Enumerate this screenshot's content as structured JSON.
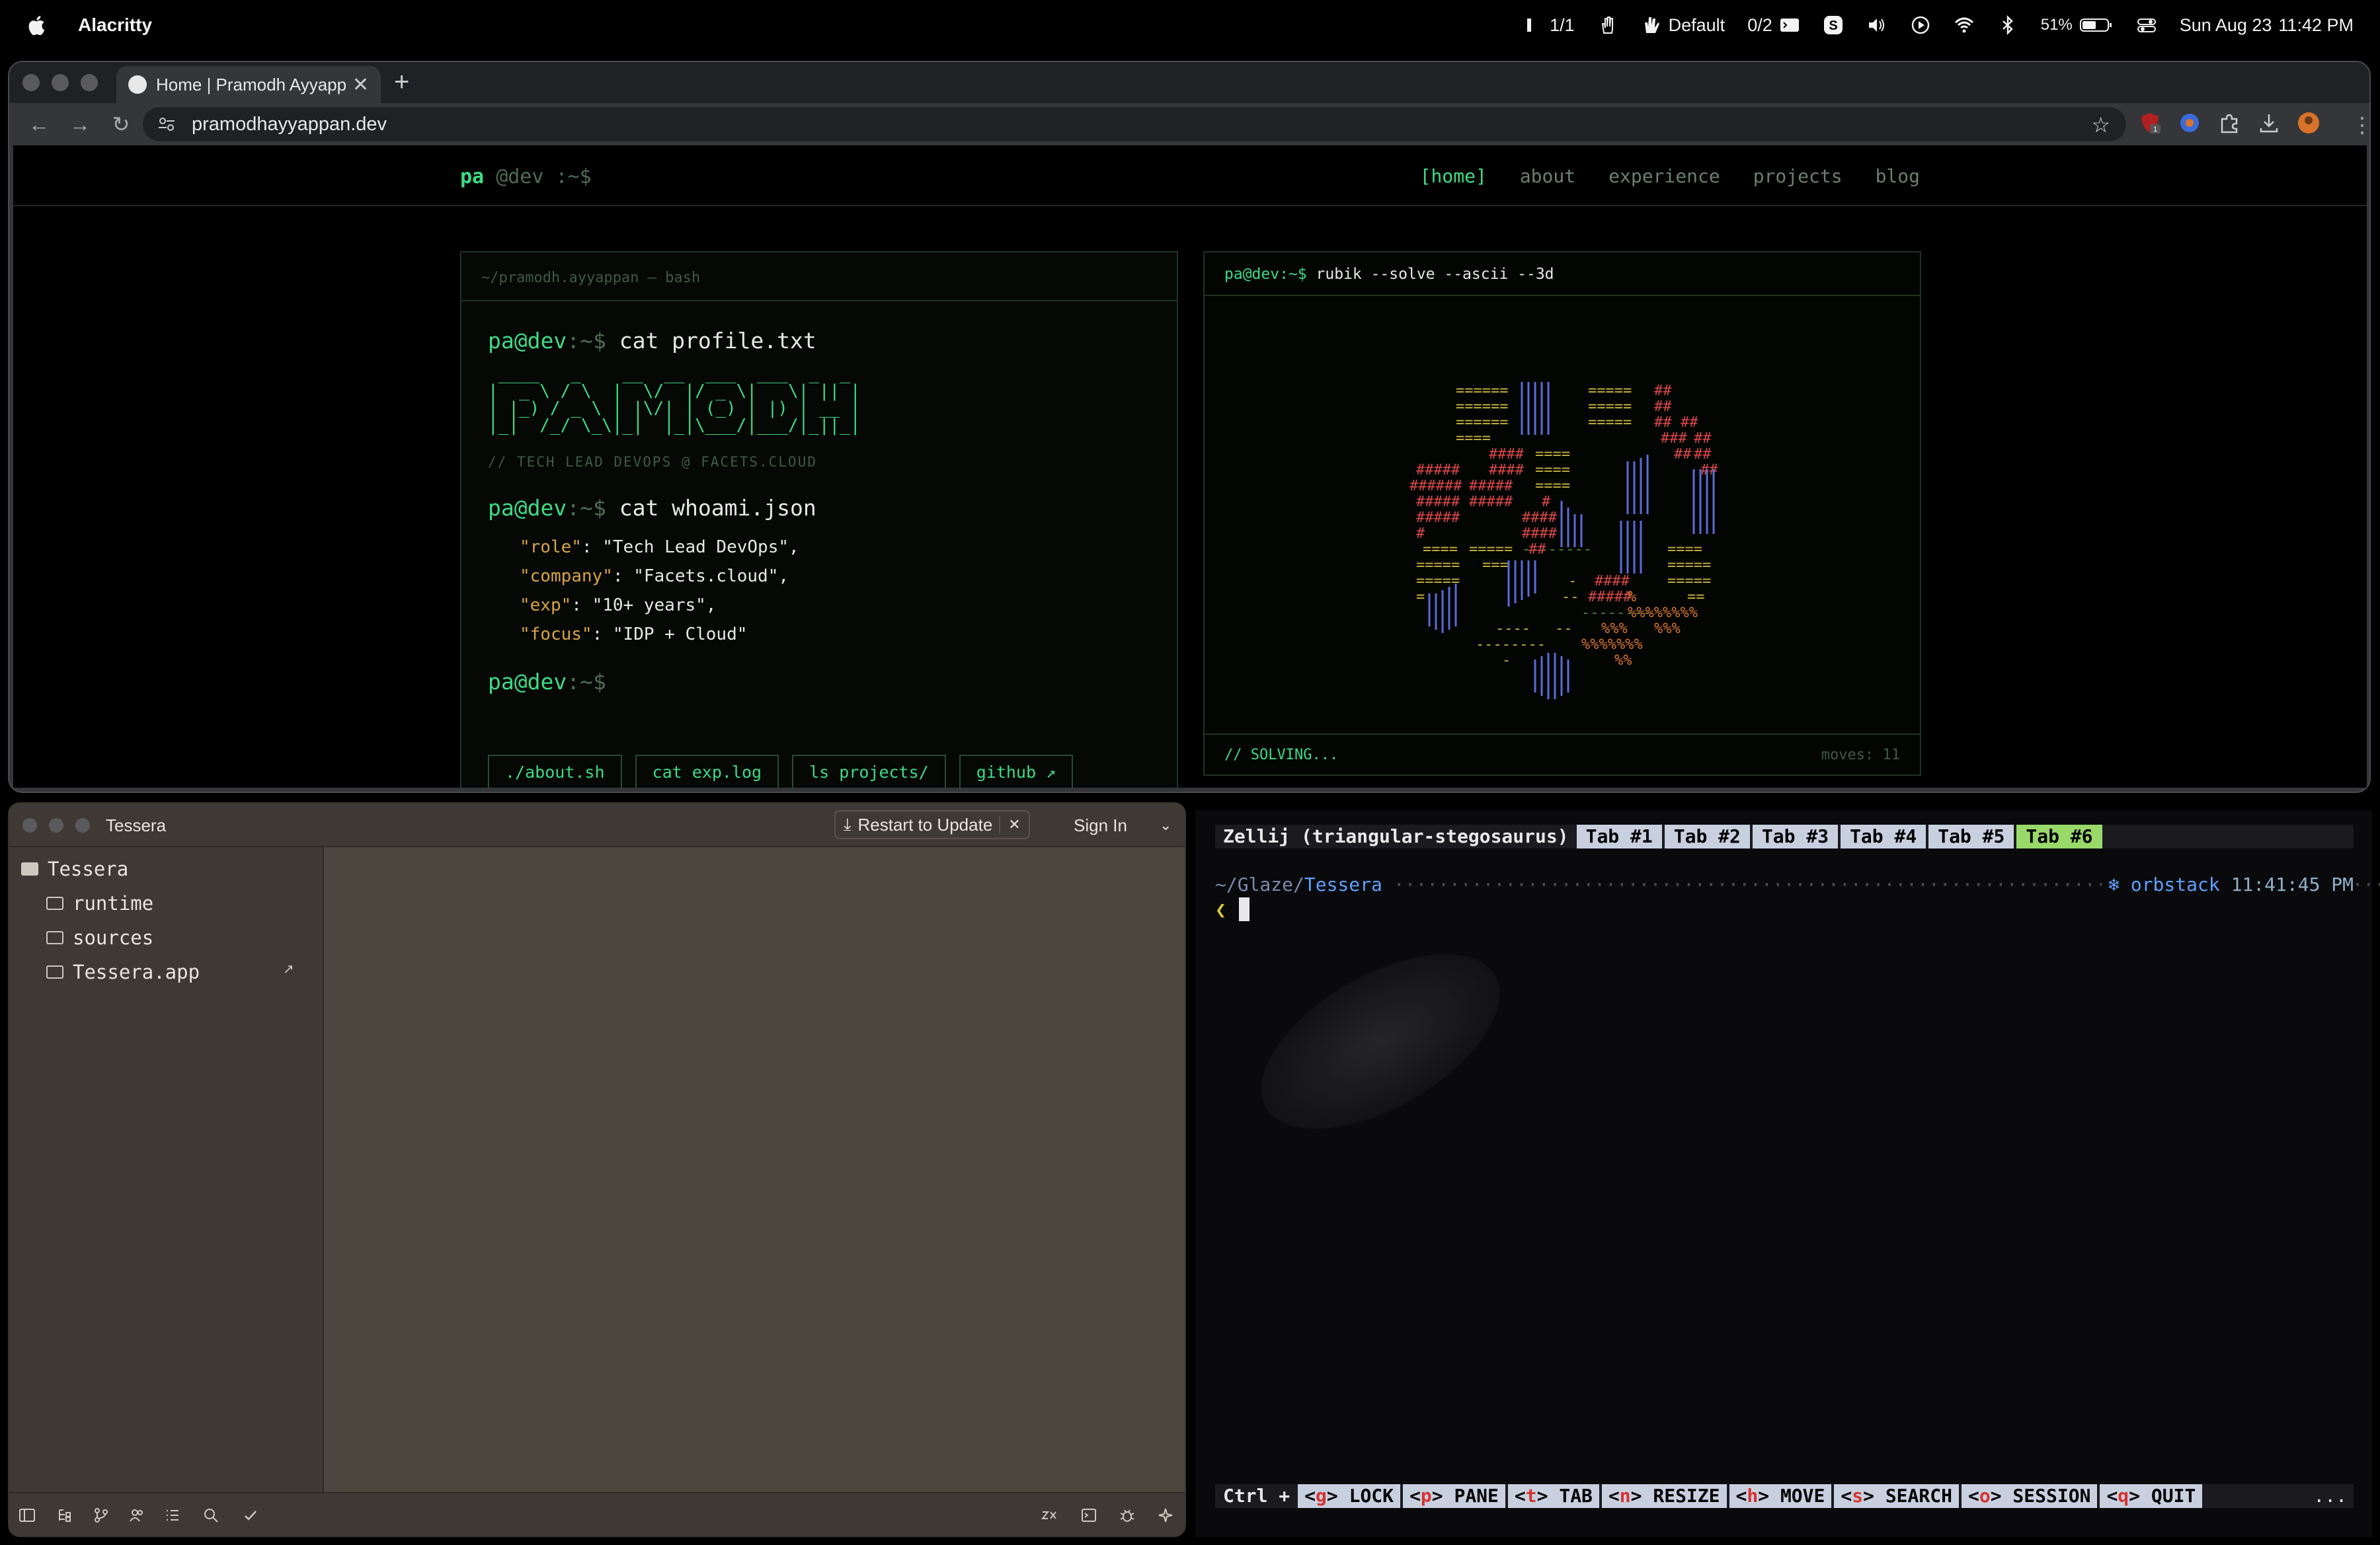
{
  "menubar": {
    "app": "Alacritty",
    "items": [
      "1/1",
      "Default",
      "0/2",
      "51%",
      "Sun Aug 23",
      "11:42 PM"
    ]
  },
  "browser": {
    "tab_title": "Home | Pramodh Ayyappan",
    "url": "pramodhayyappan.dev",
    "ext_badge": "1"
  },
  "site": {
    "logo_pa": "pa",
    "logo_dev": "@dev :~$",
    "nav": [
      "[home]",
      "about",
      "experience",
      "projects",
      "blog"
    ],
    "terminal": {
      "header": "~/pramodh.ayyappan — bash",
      "prompt_user": "pa@dev",
      "prompt_path": ":~$",
      "cmd1": "cat profile.txt",
      "tagline": "// TECH LEAD DEVOPS @ FACETS.CLOUD",
      "cmd2": "cat whoami.json",
      "json": [
        {
          "key": "\"role\"",
          "value": "\"Tech Lead DevOps\","
        },
        {
          "key": "\"company\"",
          "value": "\"Facets.cloud\","
        },
        {
          "key": "\"exp\"",
          "value": "\"10+ years\","
        },
        {
          "key": "\"focus\"",
          "value": "\"IDP + Cloud\""
        }
      ],
      "buttons": [
        "./about.sh",
        "cat exp.log",
        "ls projects/",
        "github ↗"
      ]
    },
    "cube": {
      "prompt_user": "pa@dev",
      "prompt_path": ":~$",
      "cmd": "rubik --solve --ascii --3d",
      "status": "// SOLVING...",
      "moves": "moves: 11"
    }
  },
  "tessera": {
    "title": "Tessera",
    "restart": "Restart to Update",
    "signin": "Sign In",
    "tree": [
      "Tessera",
      "runtime",
      "sources",
      "Tessera.app"
    ]
  },
  "zellij": {
    "session": "Zellij (triangular-stegosaurus)",
    "tabs": [
      "Tab #1",
      "Tab #2",
      "Tab #3",
      "Tab #4",
      "Tab #5",
      "Tab #6"
    ],
    "path_prefix": "~/Glaze/",
    "path_dir": "Tessera",
    "context": "orbstack",
    "time": "11:41:45 PM",
    "hint_lead": "Ctrl +",
    "hints": [
      {
        "key": "g",
        "label": "LOCK"
      },
      {
        "key": "p",
        "label": "PANE"
      },
      {
        "key": "t",
        "label": "TAB"
      },
      {
        "key": "n",
        "label": "RESIZE"
      },
      {
        "key": "h",
        "label": "MOVE"
      },
      {
        "key": "s",
        "label": "SEARCH"
      },
      {
        "key": "o",
        "label": "SESSION"
      },
      {
        "key": "q",
        "label": "QUIT"
      }
    ],
    "more": "..."
  }
}
